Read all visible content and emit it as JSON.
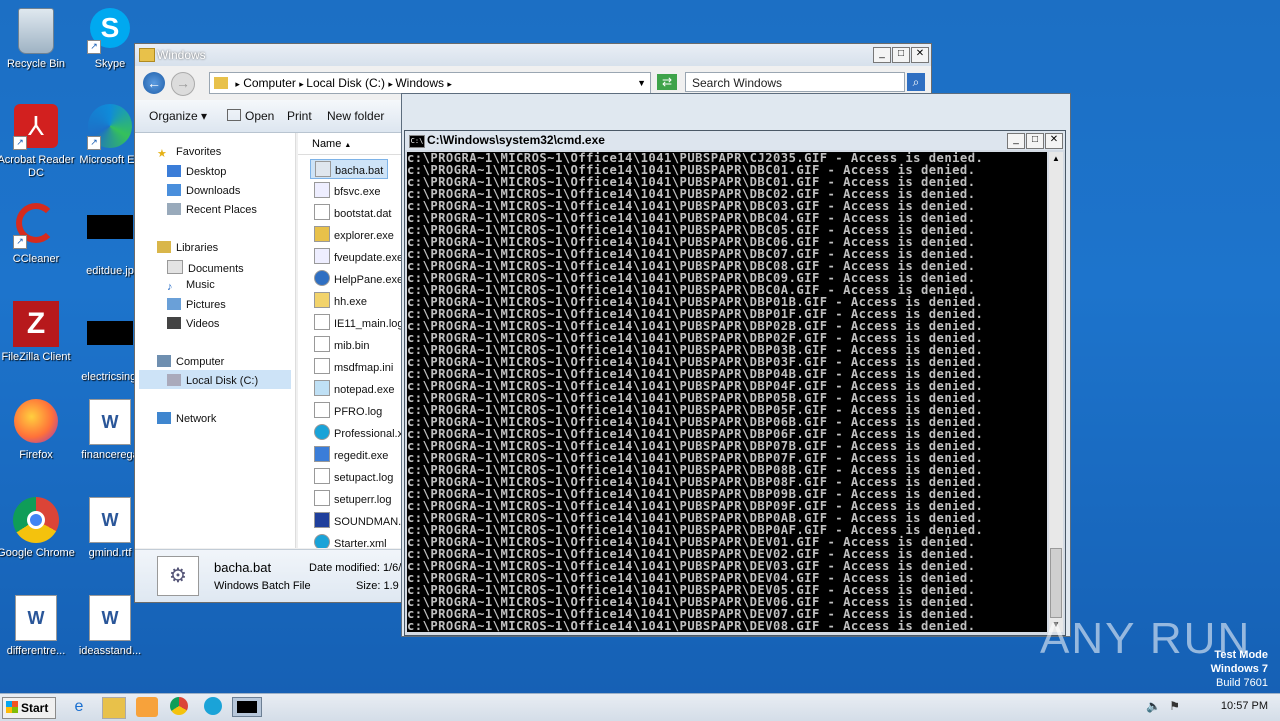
{
  "desktop": {
    "icons": [
      {
        "label": "Recycle Bin"
      },
      {
        "label": "Skype"
      },
      {
        "label": "Acrobat Reader DC"
      },
      {
        "label": "Microsoft Ed"
      },
      {
        "label": "CCleaner"
      },
      {
        "label": "editdue.jp"
      },
      {
        "label": "FileZilla Client"
      },
      {
        "label": "electricsingl"
      },
      {
        "label": "Firefox"
      },
      {
        "label": "financerega"
      },
      {
        "label": "Google Chrome"
      },
      {
        "label": "gmind.rtf"
      },
      {
        "label": "differentre..."
      },
      {
        "label": "ideasstand..."
      }
    ]
  },
  "explorer": {
    "title": "Windows",
    "address": [
      "Computer",
      "Local Disk (C:)",
      "Windows"
    ],
    "search_placeholder": "Search Windows",
    "toolbar": {
      "organize": "Organize",
      "open": "Open",
      "print": "Print",
      "new_folder": "New folder"
    },
    "nav": {
      "favorites": "Favorites",
      "desktop": "Desktop",
      "downloads": "Downloads",
      "recent": "Recent Places",
      "libraries": "Libraries",
      "documents": "Documents",
      "music": "Music",
      "pictures": "Pictures",
      "videos": "Videos",
      "computer": "Computer",
      "local_disk": "Local Disk (C:)",
      "network": "Network"
    },
    "column_name": "Name",
    "files": [
      "bacha.bat",
      "bfsvc.exe",
      "bootstat.dat",
      "explorer.exe",
      "fveupdate.exe",
      "HelpPane.exe",
      "hh.exe",
      "IE11_main.log",
      "mib.bin",
      "msdfmap.ini",
      "notepad.exe",
      "PFRO.log",
      "Professional.x",
      "regedit.exe",
      "setupact.log",
      "setuperr.log",
      "SOUNDMAN.EX",
      "Starter.xml"
    ],
    "details": {
      "name": "bacha.bat",
      "type": "Windows Batch File",
      "modified": "Date modified: 1/6/",
      "size": "Size: 1.9"
    }
  },
  "cmd": {
    "title": "C:\\Windows\\system32\\cmd.exe",
    "icon_text": "C:\\",
    "lines": [
      "c:\\PROGRA~1\\MICROS~1\\Office14\\1041\\PUBSPAPR\\CJ2035.GIF - Access is denied.",
      "c:\\PROGRA~1\\MICROS~1\\Office14\\1041\\PUBSPAPR\\DBC01.GIF - Access is denied.",
      "c:\\PROGRA~1\\MICROS~1\\Office14\\1041\\PUBSPAPR\\DBC01.GIF - Access is denied.",
      "c:\\PROGRA~1\\MICROS~1\\Office14\\1041\\PUBSPAPR\\DBC02.GIF - Access is denied.",
      "c:\\PROGRA~1\\MICROS~1\\Office14\\1041\\PUBSPAPR\\DBC03.GIF - Access is denied.",
      "c:\\PROGRA~1\\MICROS~1\\Office14\\1041\\PUBSPAPR\\DBC04.GIF - Access is denied.",
      "c:\\PROGRA~1\\MICROS~1\\Office14\\1041\\PUBSPAPR\\DBC05.GIF - Access is denied.",
      "c:\\PROGRA~1\\MICROS~1\\Office14\\1041\\PUBSPAPR\\DBC06.GIF - Access is denied.",
      "c:\\PROGRA~1\\MICROS~1\\Office14\\1041\\PUBSPAPR\\DBC07.GIF - Access is denied.",
      "c:\\PROGRA~1\\MICROS~1\\Office14\\1041\\PUBSPAPR\\DBC08.GIF - Access is denied.",
      "c:\\PROGRA~1\\MICROS~1\\Office14\\1041\\PUBSPAPR\\DBC09.GIF - Access is denied.",
      "c:\\PROGRA~1\\MICROS~1\\Office14\\1041\\PUBSPAPR\\DBC0A.GIF - Access is denied.",
      "c:\\PROGRA~1\\MICROS~1\\Office14\\1041\\PUBSPAPR\\DBP01B.GIF - Access is denied.",
      "c:\\PROGRA~1\\MICROS~1\\Office14\\1041\\PUBSPAPR\\DBP01F.GIF - Access is denied.",
      "c:\\PROGRA~1\\MICROS~1\\Office14\\1041\\PUBSPAPR\\DBP02B.GIF - Access is denied.",
      "c:\\PROGRA~1\\MICROS~1\\Office14\\1041\\PUBSPAPR\\DBP02F.GIF - Access is denied.",
      "c:\\PROGRA~1\\MICROS~1\\Office14\\1041\\PUBSPAPR\\DBP03B.GIF - Access is denied.",
      "c:\\PROGRA~1\\MICROS~1\\Office14\\1041\\PUBSPAPR\\DBP03F.GIF - Access is denied.",
      "c:\\PROGRA~1\\MICROS~1\\Office14\\1041\\PUBSPAPR\\DBP04B.GIF - Access is denied.",
      "c:\\PROGRA~1\\MICROS~1\\Office14\\1041\\PUBSPAPR\\DBP04F.GIF - Access is denied.",
      "c:\\PROGRA~1\\MICROS~1\\Office14\\1041\\PUBSPAPR\\DBP05B.GIF - Access is denied.",
      "c:\\PROGRA~1\\MICROS~1\\Office14\\1041\\PUBSPAPR\\DBP05F.GIF - Access is denied.",
      "c:\\PROGRA~1\\MICROS~1\\Office14\\1041\\PUBSPAPR\\DBP06B.GIF - Access is denied.",
      "c:\\PROGRA~1\\MICROS~1\\Office14\\1041\\PUBSPAPR\\DBP06F.GIF - Access is denied.",
      "c:\\PROGRA~1\\MICROS~1\\Office14\\1041\\PUBSPAPR\\DBP07B.GIF - Access is denied.",
      "c:\\PROGRA~1\\MICROS~1\\Office14\\1041\\PUBSPAPR\\DBP07F.GIF - Access is denied.",
      "c:\\PROGRA~1\\MICROS~1\\Office14\\1041\\PUBSPAPR\\DBP08B.GIF - Access is denied.",
      "c:\\PROGRA~1\\MICROS~1\\Office14\\1041\\PUBSPAPR\\DBP08F.GIF - Access is denied.",
      "c:\\PROGRA~1\\MICROS~1\\Office14\\1041\\PUBSPAPR\\DBP09B.GIF - Access is denied.",
      "c:\\PROGRA~1\\MICROS~1\\Office14\\1041\\PUBSPAPR\\DBP09F.GIF - Access is denied.",
      "c:\\PROGRA~1\\MICROS~1\\Office14\\1041\\PUBSPAPR\\DBP0AB.GIF - Access is denied.",
      "c:\\PROGRA~1\\MICROS~1\\Office14\\1041\\PUBSPAPR\\DBP0AF.GIF - Access is denied.",
      "c:\\PROGRA~1\\MICROS~1\\Office14\\1041\\PUBSPAPR\\DEV01.GIF - Access is denied.",
      "c:\\PROGRA~1\\MICROS~1\\Office14\\1041\\PUBSPAPR\\DEV02.GIF - Access is denied.",
      "c:\\PROGRA~1\\MICROS~1\\Office14\\1041\\PUBSPAPR\\DEV03.GIF - Access is denied.",
      "c:\\PROGRA~1\\MICROS~1\\Office14\\1041\\PUBSPAPR\\DEV04.GIF - Access is denied.",
      "c:\\PROGRA~1\\MICROS~1\\Office14\\1041\\PUBSPAPR\\DEV05.GIF - Access is denied.",
      "c:\\PROGRA~1\\MICROS~1\\Office14\\1041\\PUBSPAPR\\DEV06.GIF - Access is denied.",
      "c:\\PROGRA~1\\MICROS~1\\Office14\\1041\\PUBSPAPR\\DEV07.GIF - Access is denied.",
      "c:\\PROGRA~1\\MICROS~1\\Office14\\1041\\PUBSPAPR\\DEV08.GIF - Access is denied."
    ]
  },
  "taskbar": {
    "start": "Start",
    "clock": "10:57 PM"
  },
  "watermark": {
    "line1": "Test Mode",
    "line2": "Windows 7",
    "line3": "Build 7601",
    "brand": "ANY RUN"
  },
  "colors": {
    "desktop": "#1d6fc6",
    "console_bg": "#000000",
    "console_fg": "#c0c0c0"
  }
}
